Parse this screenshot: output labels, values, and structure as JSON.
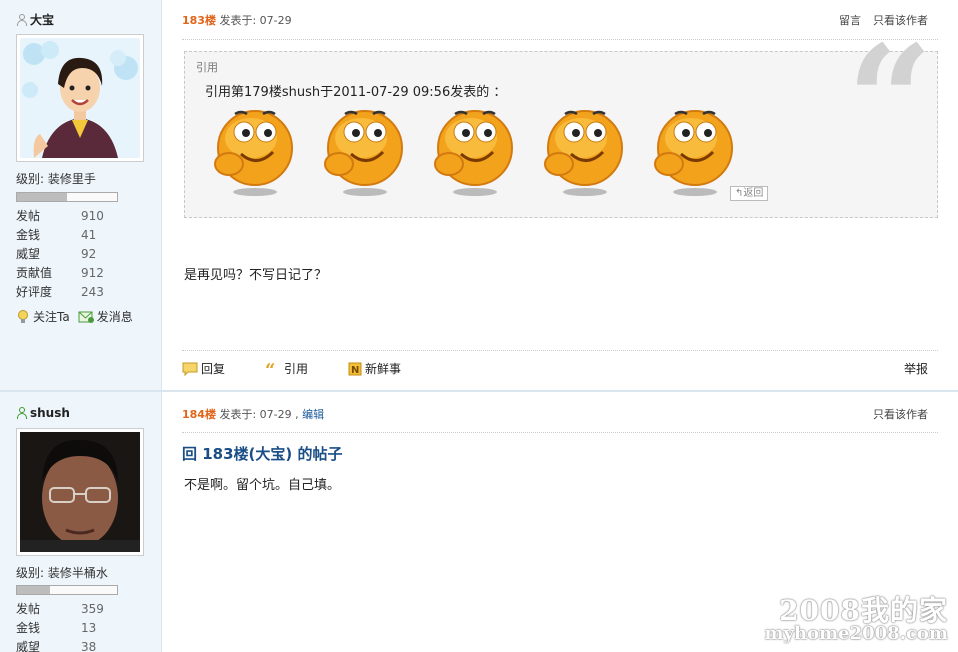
{
  "posts": [
    {
      "username": "大宝",
      "rank": "级别: 装修里手",
      "rank_progress": 0.5,
      "stats": [
        {
          "label": "发帖",
          "value": "910"
        },
        {
          "label": "金钱",
          "value": "41"
        },
        {
          "label": "威望",
          "value": "92"
        },
        {
          "label": "贡献值",
          "value": "912"
        },
        {
          "label": "好评度",
          "value": "243"
        }
      ],
      "follow_label": "关注Ta",
      "message_label": "发消息",
      "floor": "183楼",
      "posted": "发表于: 07-29",
      "actions_right": [
        "留言",
        "只看该作者"
      ],
      "quote": {
        "label": "引用",
        "text": "引用第179楼shush于2011-07-29 09:56发表的 ：",
        "back_label": "返回",
        "emoticon_count": 5
      },
      "content": "是再见吗？不写日记了？",
      "ops": {
        "reply": "回复",
        "cite": "引用",
        "fresh": "新鲜事",
        "report": "举报"
      }
    },
    {
      "username": "shush",
      "rank": "级别: 装修半桶水",
      "rank_progress": 0.33,
      "stats": [
        {
          "label": "发帖",
          "value": "359"
        },
        {
          "label": "金钱",
          "value": "13"
        },
        {
          "label": "威望",
          "value": "38"
        }
      ],
      "floor": "184楼",
      "posted": "发表于: 07-29 ,",
      "edit_label": "编辑",
      "actions_right": [
        "只看该作者"
      ],
      "reply_title": "回  183楼(大宝) 的帖子",
      "content": "不是啊。留个坑。自己填。"
    }
  ],
  "watermark": {
    "line1": "2008我的家",
    "line2": "myhome2008.com"
  }
}
